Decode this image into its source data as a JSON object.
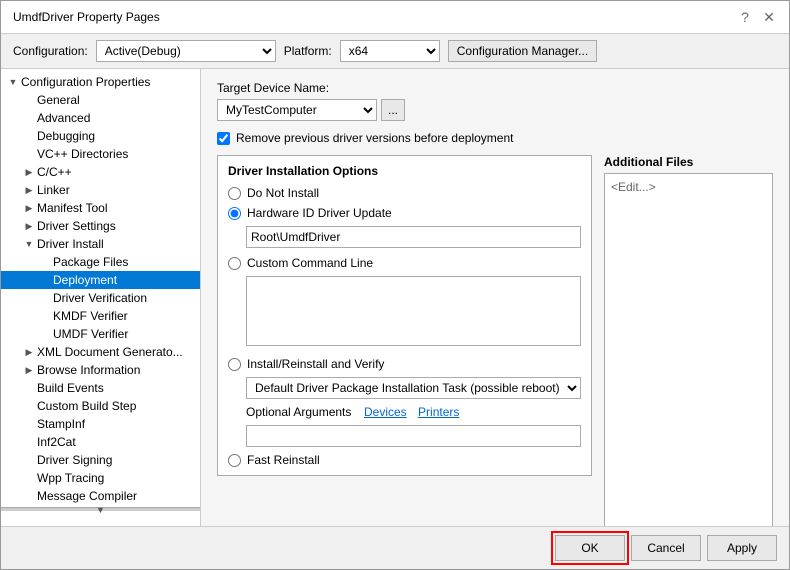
{
  "window": {
    "title": "UmdfDriver Property Pages",
    "help_btn": "?",
    "close_btn": "✕"
  },
  "config_bar": {
    "config_label": "Configuration:",
    "config_value": "Active(Debug)",
    "platform_label": "Platform:",
    "platform_value": "x64",
    "manager_btn": "Configuration Manager..."
  },
  "tree": {
    "items": [
      {
        "id": "config-props",
        "label": "Configuration Properties",
        "level": 0,
        "expanded": true,
        "has_children": true
      },
      {
        "id": "general",
        "label": "General",
        "level": 1,
        "expanded": false,
        "has_children": false
      },
      {
        "id": "advanced",
        "label": "Advanced",
        "level": 1,
        "expanded": false,
        "has_children": false
      },
      {
        "id": "debugging",
        "label": "Debugging",
        "level": 1,
        "expanded": false,
        "has_children": false
      },
      {
        "id": "vc-directories",
        "label": "VC++ Directories",
        "level": 1,
        "expanded": false,
        "has_children": false
      },
      {
        "id": "cpp",
        "label": "C/C++",
        "level": 1,
        "expanded": false,
        "has_children": true,
        "collapsed": true
      },
      {
        "id": "linker",
        "label": "Linker",
        "level": 1,
        "expanded": false,
        "has_children": true,
        "collapsed": true
      },
      {
        "id": "manifest-tool",
        "label": "Manifest Tool",
        "level": 1,
        "expanded": false,
        "has_children": true,
        "collapsed": true
      },
      {
        "id": "driver-settings",
        "label": "Driver Settings",
        "level": 1,
        "expanded": false,
        "has_children": true,
        "collapsed": true
      },
      {
        "id": "driver-install",
        "label": "Driver Install",
        "level": 1,
        "expanded": true,
        "has_children": true
      },
      {
        "id": "package-files",
        "label": "Package Files",
        "level": 2,
        "expanded": false,
        "has_children": false
      },
      {
        "id": "deployment",
        "label": "Deployment",
        "level": 2,
        "expanded": false,
        "has_children": false,
        "selected": true
      },
      {
        "id": "driver-verification",
        "label": "Driver Verification",
        "level": 2,
        "expanded": false,
        "has_children": false
      },
      {
        "id": "kmdf-verifier",
        "label": "KMDF Verifier",
        "level": 2,
        "expanded": false,
        "has_children": false
      },
      {
        "id": "umdf-verifier",
        "label": "UMDF Verifier",
        "level": 2,
        "expanded": false,
        "has_children": false
      },
      {
        "id": "xml-doc",
        "label": "XML Document Generato...",
        "level": 1,
        "expanded": false,
        "has_children": true,
        "collapsed": true
      },
      {
        "id": "browse-info",
        "label": "Browse Information",
        "level": 1,
        "expanded": false,
        "has_children": true,
        "collapsed": true
      },
      {
        "id": "build-events",
        "label": "Build Events",
        "level": 1,
        "expanded": false,
        "has_children": false
      },
      {
        "id": "custom-build",
        "label": "Custom Build Step",
        "level": 1,
        "expanded": false,
        "has_children": false
      },
      {
        "id": "stampinf",
        "label": "StampInf",
        "level": 1,
        "expanded": false,
        "has_children": false
      },
      {
        "id": "inf2cat",
        "label": "Inf2Cat",
        "level": 1,
        "expanded": false,
        "has_children": false
      },
      {
        "id": "driver-signing",
        "label": "Driver Signing",
        "level": 1,
        "expanded": false,
        "has_children": false
      },
      {
        "id": "wpp-tracing",
        "label": "Wpp Tracing",
        "level": 1,
        "expanded": false,
        "has_children": false
      },
      {
        "id": "message-compiler",
        "label": "Message Compiler",
        "level": 1,
        "expanded": false,
        "has_children": false
      }
    ]
  },
  "content": {
    "target_device_label": "Target Device Name:",
    "target_device_value": "MyTestComputer",
    "ellipsis_btn": "...",
    "remove_checkbox_label": "Remove previous driver versions before deployment",
    "remove_checked": true,
    "driver_install_section_title": "Driver Installation Options",
    "radio_do_not_install": "Do Not Install",
    "radio_hardware_id": "Hardware ID Driver Update",
    "hardware_id_value": "Root\\UmdfDriver",
    "radio_custom_cmd": "Custom Command Line",
    "custom_cmd_placeholder": "",
    "radio_install_reinstall": "Install/Reinstall and Verify",
    "install_select_value": "Default Driver Package Installation Task (possible reboot)",
    "optional_args_label": "Optional Arguments",
    "devices_link": "Devices",
    "printers_link": "Printers",
    "optional_args_value": "",
    "radio_fast_reinstall": "Fast Reinstall",
    "additional_files_title": "Additional Files",
    "additional_files_placeholder": "<Edit...>",
    "ok_btn": "OK",
    "cancel_btn": "Cancel",
    "apply_btn": "Apply"
  }
}
